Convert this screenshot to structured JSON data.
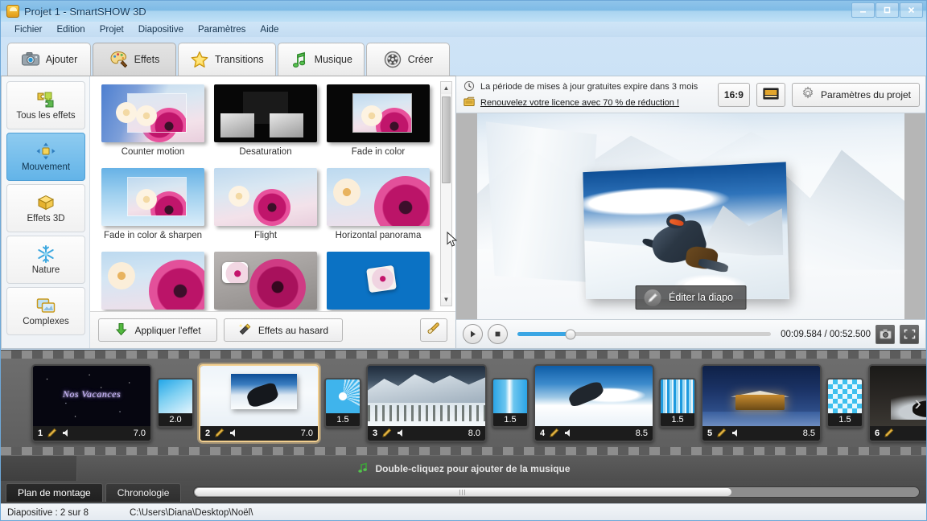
{
  "window": {
    "title": "Projet 1 - SmartSHOW 3D",
    "minimize_label": "–",
    "maximize_label": "❑",
    "close_label": "×"
  },
  "menubar": {
    "items": [
      "Fichier",
      "Edition",
      "Projet",
      "Diapositive",
      "Paramètres",
      "Aide"
    ]
  },
  "tabs": [
    {
      "label": "Ajouter",
      "icon": "camera-icon",
      "active": false
    },
    {
      "label": "Effets",
      "icon": "palette-icon",
      "active": true
    },
    {
      "label": "Transitions",
      "icon": "star-icon",
      "active": false
    },
    {
      "label": "Musique",
      "icon": "music-note-icon",
      "active": false
    },
    {
      "label": "Créer",
      "icon": "film-reel-icon",
      "active": false
    }
  ],
  "categories": [
    {
      "label": "Tous les effets",
      "icon": "puzzle-icon",
      "active": false
    },
    {
      "label": "Mouvement",
      "icon": "move-arrows-icon",
      "active": true
    },
    {
      "label": "Effets 3D",
      "icon": "cube-icon",
      "active": false
    },
    {
      "label": "Nature",
      "icon": "snowflake-icon",
      "active": false
    },
    {
      "label": "Complexes",
      "icon": "layers-icon",
      "active": false
    }
  ],
  "effects": [
    {
      "label": "Counter motion",
      "art": "counter-motion"
    },
    {
      "label": "Desaturation",
      "art": "desaturation"
    },
    {
      "label": "Fade in color",
      "art": "fade-in-color"
    },
    {
      "label": "Fade in color & sharpen",
      "art": "fade-sharpen"
    },
    {
      "label": "Flight",
      "art": "flight"
    },
    {
      "label": "Horizontal panorama",
      "art": "panorama"
    },
    {
      "label": "",
      "art": "row3-a"
    },
    {
      "label": "",
      "art": "row3-b"
    },
    {
      "label": "",
      "art": "row3-c"
    }
  ],
  "effect_actions": {
    "apply_label": "Appliquer l'effet",
    "random_label": "Effets au hasard",
    "clear_label": ""
  },
  "notice": {
    "line1": "La période de mises à jour gratuites expire dans 3 mois",
    "line2": "Renouvelez votre licence avec 70 % de réduction !",
    "ratio_label": "16:9",
    "quality_label": "",
    "project_settings_label": "Paramètres du projet"
  },
  "preview": {
    "edit_slide_label": "Éditer la diapo"
  },
  "player": {
    "play_label": "▶",
    "stop_label": "■",
    "timecode": "00:09.584 / 00:52.500",
    "current_time": "00:09.584",
    "total_time": "00:52.500",
    "progress_percent": 21
  },
  "timeline": {
    "slides": [
      {
        "number": "1",
        "duration": "7.0",
        "art": "stars-title",
        "title_text": "Nos Vacances",
        "selected": false
      },
      {
        "number": "2",
        "duration": "7.0",
        "art": "snowboard",
        "title_text": "",
        "selected": true
      },
      {
        "number": "3",
        "duration": "8.0",
        "art": "mountain-village",
        "title_text": "",
        "selected": false
      },
      {
        "number": "4",
        "duration": "8.5",
        "art": "snowboard-jump",
        "title_text": "",
        "selected": false
      },
      {
        "number": "5",
        "duration": "8.5",
        "art": "night-cabin",
        "title_text": "",
        "selected": false
      },
      {
        "number": "6",
        "duration": "",
        "art": "dark-scene",
        "title_text": "",
        "selected": false
      }
    ],
    "transitions": [
      {
        "duration": "2.0",
        "art": "wave"
      },
      {
        "duration": "1.5",
        "art": "ray"
      },
      {
        "duration": "1.5",
        "art": "beam"
      },
      {
        "duration": "1.5",
        "art": "blinds"
      },
      {
        "duration": "1.5",
        "art": "checker"
      }
    ],
    "next_arrow": "›"
  },
  "music": {
    "hint": "Double-cliquez pour ajouter de la musique"
  },
  "bottom_tabs": [
    {
      "label": "Plan de montage",
      "active": true
    },
    {
      "label": "Chronologie",
      "active": false
    }
  ],
  "statusbar": {
    "slide_info": "Diapositive : 2 sur 8",
    "path": "C:\\Users\\Diana\\Desktop\\Noël\\"
  },
  "colors": {
    "titlebar": "#7fbbe6",
    "accent_blue": "#3aa6e4",
    "selected_slide": "#f2cf8f",
    "category_active": "#63b4e8",
    "timeline_bg": "#5e5e5e"
  }
}
